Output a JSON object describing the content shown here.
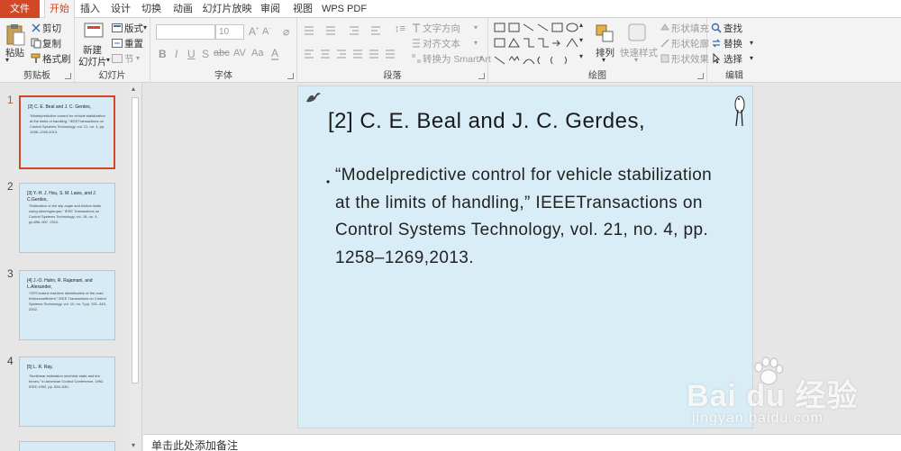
{
  "tabs": [
    "文件",
    "开始",
    "插入",
    "设计",
    "切换",
    "动画",
    "幻灯片放映",
    "审阅",
    "视图",
    "WPS PDF"
  ],
  "ribbon": {
    "clipboard": {
      "paste": "粘贴",
      "cut": "剪切",
      "copy": "复制",
      "format_painter": "格式刷",
      "label": "剪贴板"
    },
    "slides": {
      "new_slide_1": "新建",
      "new_slide_2": "幻灯片",
      "layout": "版式",
      "reset": "重置",
      "section": "节",
      "label": "幻灯片"
    },
    "font": {
      "size": "10",
      "label": "字体"
    },
    "paragraph": {
      "text_direction": "文字方向",
      "align_text": "对齐文本",
      "smartart": "转换为 SmartArt",
      "label": "段落"
    },
    "drawing": {
      "arrange": "排列",
      "quick_styles": "快速样式",
      "fill": "形状填充",
      "outline": "形状轮廓",
      "effects": "形状效果",
      "label": "绘图"
    },
    "editing": {
      "find": "查找",
      "replace": "替换",
      "select": "选择",
      "label": "编辑"
    }
  },
  "thumbnails": [
    {
      "num": "1",
      "title": "[2] C. E. Beal and J. C. Gerdes,",
      "body": "“Modelpredictive control for vehicle stabilization at the limits of handling,” IEEETransactions on Control Systems Technology, vol. 21, no. 4, pp. 1258–1269,2013."
    },
    {
      "num": "2",
      "title": "[3] Y.-H. J. Hsu, S. M. Laws, and J. C.Gerdes,",
      "body": "“Estimation of tire slip angle and friction limits using steeringtorque,” IEEE Transactions on Control Systems Technology, vol. 18, no. 4, pp.896–907, 2010."
    },
    {
      "num": "3",
      "title": "[4] J.-O. Hahn, R. Rajamani, and L.Alexander,",
      "body": "“GPS-based real-time identification of tire-road frictioncoefficient,” IEEE Transactions on Control Systems Technology, vol. 10, no. 3,pp. 331–343, 2002."
    },
    {
      "num": "4",
      "title": "[5] L. R. Ray,",
      "body": "“Nonlinear estimation ofvehicle state and tire forces,” in American Control Conference, 1992. IEEE,1992, pp. 526–530."
    }
  ],
  "slide": {
    "title": "[2] C. E. Beal and J. C. Gerdes,",
    "bullet": "•",
    "body": "“Modelpredictive control for vehicle stabilization at the limits of handling,” IEEETransactions on Control Systems Technology, vol. 21, no. 4, pp. 1258–1269,2013."
  },
  "notes_placeholder": "单击此处添加备注",
  "watermark": {
    "text": "Bai du 经验",
    "url": "jingyan.baidu.com"
  },
  "colors": {
    "accent": "#d24726",
    "slide_bg": "#d9edf7",
    "ribbon_bg": "#f3f3f3"
  }
}
